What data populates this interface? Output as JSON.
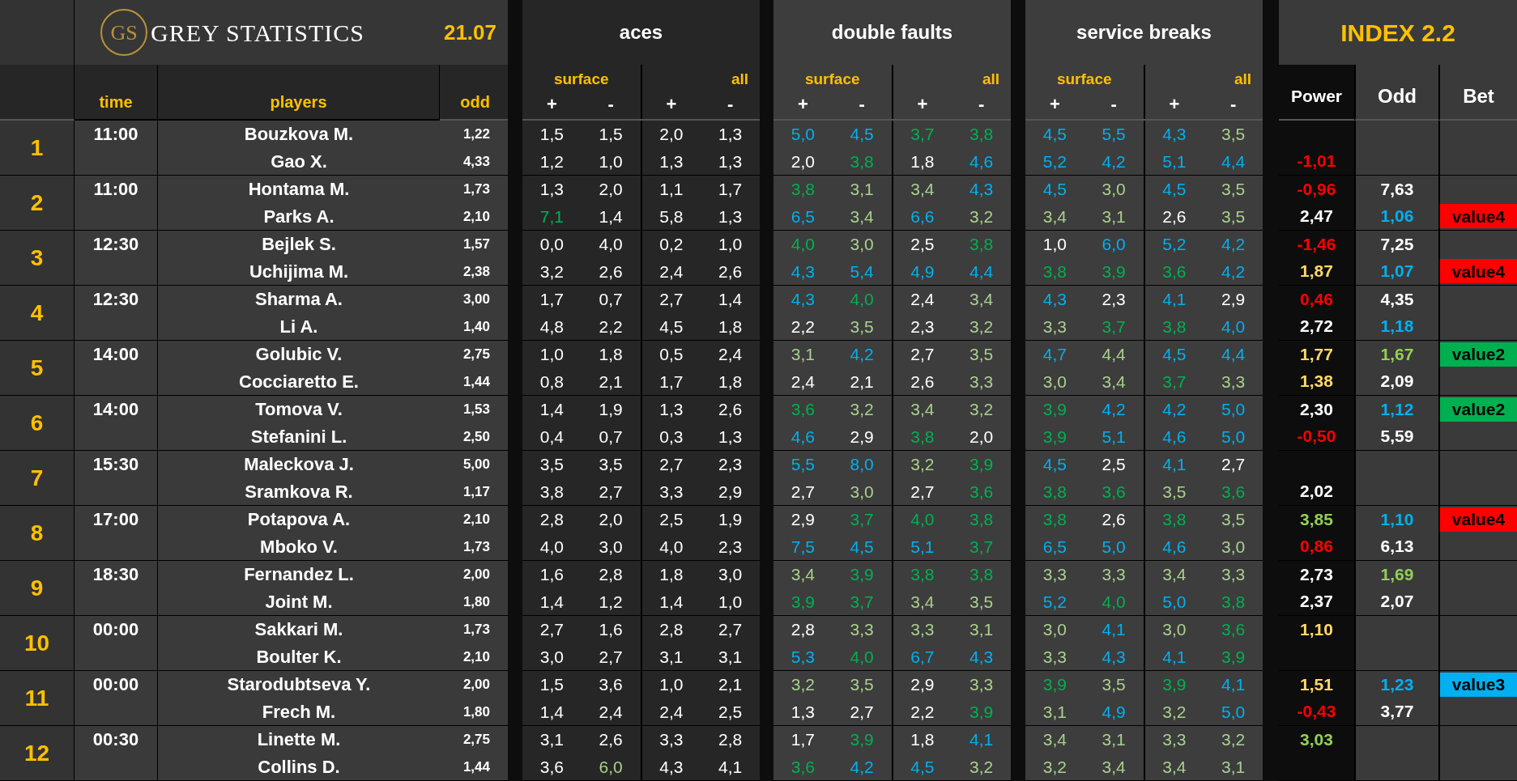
{
  "header": {
    "logo_mark": "GS",
    "brand": "GREY STATISTICS",
    "date": "21.07",
    "index_title": "INDEX 2.2"
  },
  "columns": {
    "time": "time",
    "players": "players",
    "odd": "odd",
    "power": "Power",
    "index_odd": "Odd",
    "bet": "Bet"
  },
  "groups": [
    {
      "title": "aces",
      "subgroups": [
        {
          "label": "surface",
          "signs": [
            "+",
            "-"
          ]
        },
        {
          "label": "all",
          "signs": [
            "+",
            "-"
          ]
        }
      ]
    },
    {
      "title": "double faults",
      "subgroups": [
        {
          "label": "surface",
          "signs": [
            "+",
            "-"
          ]
        },
        {
          "label": "all",
          "signs": [
            "+",
            "-"
          ]
        }
      ]
    },
    {
      "title": "service breaks",
      "subgroups": [
        {
          "label": "surface",
          "signs": [
            "+",
            "-"
          ]
        },
        {
          "label": "all",
          "signs": [
            "+",
            "-"
          ]
        }
      ]
    }
  ],
  "matches": [
    {
      "number": "1",
      "time": "11:00",
      "players": [
        {
          "name": "Bouzkova M.",
          "odd": "1,22",
          "stats": [
            {
              "text": "1,5",
              "color": "#ffffff"
            },
            {
              "text": "1,5",
              "color": "#ffffff"
            },
            {
              "text": "2,0",
              "color": "#ffffff"
            },
            {
              "text": "1,3",
              "color": "#ffffff"
            },
            {
              "text": "5,0",
              "color": "#00b0f0"
            },
            {
              "text": "4,5",
              "color": "#00b0f0"
            },
            {
              "text": "3,7",
              "color": "#00b050"
            },
            {
              "text": "3,8",
              "color": "#00b050"
            },
            {
              "text": "4,5",
              "color": "#00b0f0"
            },
            {
              "text": "5,5",
              "color": "#00b0f0"
            },
            {
              "text": "4,3",
              "color": "#00b0f0"
            },
            {
              "text": "3,5",
              "color": "#a9d08e"
            }
          ]
        },
        {
          "name": "Gao X.",
          "odd": "4,33",
          "stats": [
            {
              "text": "1,2",
              "color": "#ffffff"
            },
            {
              "text": "1,0",
              "color": "#ffffff"
            },
            {
              "text": "1,3",
              "color": "#ffffff"
            },
            {
              "text": "1,3",
              "color": "#ffffff"
            },
            {
              "text": "2,0",
              "color": "#ffffff"
            },
            {
              "text": "3,8",
              "color": "#00b050"
            },
            {
              "text": "1,8",
              "color": "#ffffff"
            },
            {
              "text": "4,6",
              "color": "#00b0f0"
            },
            {
              "text": "5,2",
              "color": "#00b0f0"
            },
            {
              "text": "4,2",
              "color": "#00b0f0"
            },
            {
              "text": "5,1",
              "color": "#00b0f0"
            },
            {
              "text": "4,4",
              "color": "#00b0f0"
            }
          ],
          "power": {
            "text": "-1,01",
            "color": "#ff0000"
          }
        }
      ]
    },
    {
      "number": "2",
      "time": "11:00",
      "players": [
        {
          "name": "Hontama M.",
          "odd": "1,73",
          "stats": [
            {
              "text": "1,3",
              "color": "#ffffff"
            },
            {
              "text": "2,0",
              "color": "#ffffff"
            },
            {
              "text": "1,1",
              "color": "#ffffff"
            },
            {
              "text": "1,7",
              "color": "#ffffff"
            },
            {
              "text": "3,8",
              "color": "#00b050"
            },
            {
              "text": "3,1",
              "color": "#a9d08e"
            },
            {
              "text": "3,4",
              "color": "#a9d08e"
            },
            {
              "text": "4,3",
              "color": "#00b0f0"
            },
            {
              "text": "4,5",
              "color": "#00b0f0"
            },
            {
              "text": "3,0",
              "color": "#a9d08e"
            },
            {
              "text": "4,5",
              "color": "#00b0f0"
            },
            {
              "text": "3,5",
              "color": "#a9d08e"
            }
          ],
          "power": {
            "text": "-0,96",
            "color": "#ff0000"
          },
          "index_odd": {
            "text": "7,63",
            "color": "#ffffff"
          }
        },
        {
          "name": "Parks A.",
          "odd": "2,10",
          "stats": [
            {
              "text": "7,1",
              "color": "#00b050"
            },
            {
              "text": "1,4",
              "color": "#ffffff"
            },
            {
              "text": "5,8",
              "color": "#ffffff"
            },
            {
              "text": "1,3",
              "color": "#ffffff"
            },
            {
              "text": "6,5",
              "color": "#00b0f0"
            },
            {
              "text": "3,4",
              "color": "#a9d08e"
            },
            {
              "text": "6,6",
              "color": "#00b0f0"
            },
            {
              "text": "3,2",
              "color": "#a9d08e"
            },
            {
              "text": "3,4",
              "color": "#a9d08e"
            },
            {
              "text": "3,1",
              "color": "#a9d08e"
            },
            {
              "text": "2,6",
              "color": "#ffffff"
            },
            {
              "text": "3,5",
              "color": "#a9d08e"
            }
          ],
          "power": {
            "text": "2,47",
            "color": "#ffffff"
          },
          "index_odd": {
            "text": "1,06",
            "color": "#00b0f0"
          },
          "bet": {
            "text": "value4",
            "color": "#ff0000"
          }
        }
      ]
    },
    {
      "number": "3",
      "time": "12:30",
      "players": [
        {
          "name": "Bejlek S.",
          "odd": "1,57",
          "stats": [
            {
              "text": "0,0",
              "color": "#ffffff"
            },
            {
              "text": "4,0",
              "color": "#ffffff"
            },
            {
              "text": "0,2",
              "color": "#ffffff"
            },
            {
              "text": "1,0",
              "color": "#ffffff"
            },
            {
              "text": "4,0",
              "color": "#00b050"
            },
            {
              "text": "3,0",
              "color": "#a9d08e"
            },
            {
              "text": "2,5",
              "color": "#ffffff"
            },
            {
              "text": "3,8",
              "color": "#00b050"
            },
            {
              "text": "1,0",
              "color": "#ffffff"
            },
            {
              "text": "6,0",
              "color": "#00b0f0"
            },
            {
              "text": "5,2",
              "color": "#00b0f0"
            },
            {
              "text": "4,2",
              "color": "#00b0f0"
            }
          ],
          "power": {
            "text": "-1,46",
            "color": "#ff0000"
          },
          "index_odd": {
            "text": "7,25",
            "color": "#ffffff"
          }
        },
        {
          "name": "Uchijima M.",
          "odd": "2,38",
          "stats": [
            {
              "text": "3,2",
              "color": "#ffffff"
            },
            {
              "text": "2,6",
              "color": "#ffffff"
            },
            {
              "text": "2,4",
              "color": "#ffffff"
            },
            {
              "text": "2,6",
              "color": "#ffffff"
            },
            {
              "text": "4,3",
              "color": "#00b0f0"
            },
            {
              "text": "5,4",
              "color": "#00b0f0"
            },
            {
              "text": "4,9",
              "color": "#00b0f0"
            },
            {
              "text": "4,4",
              "color": "#00b0f0"
            },
            {
              "text": "3,8",
              "color": "#00b050"
            },
            {
              "text": "3,9",
              "color": "#00b050"
            },
            {
              "text": "3,6",
              "color": "#00b050"
            },
            {
              "text": "4,2",
              "color": "#00b0f0"
            }
          ],
          "power": {
            "text": "1,87",
            "color": "#ffd966"
          },
          "index_odd": {
            "text": "1,07",
            "color": "#00b0f0"
          },
          "bet": {
            "text": "value4",
            "color": "#ff0000"
          }
        }
      ]
    },
    {
      "number": "4",
      "time": "12:30",
      "players": [
        {
          "name": "Sharma A.",
          "odd": "3,00",
          "stats": [
            {
              "text": "1,7",
              "color": "#ffffff"
            },
            {
              "text": "0,7",
              "color": "#ffffff"
            },
            {
              "text": "2,7",
              "color": "#ffffff"
            },
            {
              "text": "1,4",
              "color": "#ffffff"
            },
            {
              "text": "4,3",
              "color": "#00b0f0"
            },
            {
              "text": "4,0",
              "color": "#00b050"
            },
            {
              "text": "2,4",
              "color": "#ffffff"
            },
            {
              "text": "3,4",
              "color": "#a9d08e"
            },
            {
              "text": "4,3",
              "color": "#00b0f0"
            },
            {
              "text": "2,3",
              "color": "#ffffff"
            },
            {
              "text": "4,1",
              "color": "#00b0f0"
            },
            {
              "text": "2,9",
              "color": "#ffffff"
            }
          ],
          "power": {
            "text": "0,46",
            "color": "#ff0000"
          },
          "index_odd": {
            "text": "4,35",
            "color": "#ffffff"
          }
        },
        {
          "name": "Li A.",
          "odd": "1,40",
          "stats": [
            {
              "text": "4,8",
              "color": "#ffffff"
            },
            {
              "text": "2,2",
              "color": "#ffffff"
            },
            {
              "text": "4,5",
              "color": "#ffffff"
            },
            {
              "text": "1,8",
              "color": "#ffffff"
            },
            {
              "text": "2,2",
              "color": "#ffffff"
            },
            {
              "text": "3,5",
              "color": "#a9d08e"
            },
            {
              "text": "2,3",
              "color": "#ffffff"
            },
            {
              "text": "3,2",
              "color": "#a9d08e"
            },
            {
              "text": "3,3",
              "color": "#a9d08e"
            },
            {
              "text": "3,7",
              "color": "#00b050"
            },
            {
              "text": "3,8",
              "color": "#00b050"
            },
            {
              "text": "4,0",
              "color": "#00b0f0"
            }
          ],
          "power": {
            "text": "2,72",
            "color": "#ffffff"
          },
          "index_odd": {
            "text": "1,18",
            "color": "#00b0f0"
          }
        }
      ]
    },
    {
      "number": "5",
      "time": "14:00",
      "players": [
        {
          "name": "Golubic V.",
          "odd": "2,75",
          "stats": [
            {
              "text": "1,0",
              "color": "#ffffff"
            },
            {
              "text": "1,8",
              "color": "#ffffff"
            },
            {
              "text": "0,5",
              "color": "#ffffff"
            },
            {
              "text": "2,4",
              "color": "#ffffff"
            },
            {
              "text": "3,1",
              "color": "#a9d08e"
            },
            {
              "text": "4,2",
              "color": "#00b0f0"
            },
            {
              "text": "2,7",
              "color": "#ffffff"
            },
            {
              "text": "3,5",
              "color": "#a9d08e"
            },
            {
              "text": "4,7",
              "color": "#00b0f0"
            },
            {
              "text": "4,4",
              "color": "#a9d08e"
            },
            {
              "text": "4,5",
              "color": "#00b0f0"
            },
            {
              "text": "4,4",
              "color": "#00b0f0"
            }
          ],
          "power": {
            "text": "1,77",
            "color": "#ffd966"
          },
          "index_odd": {
            "text": "1,67",
            "color": "#92d050"
          },
          "bet": {
            "text": "value2",
            "color": "#00b050"
          }
        },
        {
          "name": "Cocciaretto E.",
          "odd": "1,44",
          "stats": [
            {
              "text": "0,8",
              "color": "#ffffff"
            },
            {
              "text": "2,1",
              "color": "#ffffff"
            },
            {
              "text": "1,7",
              "color": "#ffffff"
            },
            {
              "text": "1,8",
              "color": "#ffffff"
            },
            {
              "text": "2,4",
              "color": "#ffffff"
            },
            {
              "text": "2,1",
              "color": "#ffffff"
            },
            {
              "text": "2,6",
              "color": "#ffffff"
            },
            {
              "text": "3,3",
              "color": "#a9d08e"
            },
            {
              "text": "3,0",
              "color": "#a9d08e"
            },
            {
              "text": "3,4",
              "color": "#a9d08e"
            },
            {
              "text": "3,7",
              "color": "#00b050"
            },
            {
              "text": "3,3",
              "color": "#a9d08e"
            }
          ],
          "power": {
            "text": "1,38",
            "color": "#ffd966"
          },
          "index_odd": {
            "text": "2,09",
            "color": "#ffffff"
          }
        }
      ]
    },
    {
      "number": "6",
      "time": "14:00",
      "players": [
        {
          "name": "Tomova V.",
          "odd": "1,53",
          "stats": [
            {
              "text": "1,4",
              "color": "#ffffff"
            },
            {
              "text": "1,9",
              "color": "#ffffff"
            },
            {
              "text": "1,3",
              "color": "#ffffff"
            },
            {
              "text": "2,6",
              "color": "#ffffff"
            },
            {
              "text": "3,6",
              "color": "#00b050"
            },
            {
              "text": "3,2",
              "color": "#a9d08e"
            },
            {
              "text": "3,4",
              "color": "#a9d08e"
            },
            {
              "text": "3,2",
              "color": "#a9d08e"
            },
            {
              "text": "3,9",
              "color": "#00b050"
            },
            {
              "text": "4,2",
              "color": "#00b0f0"
            },
            {
              "text": "4,2",
              "color": "#00b0f0"
            },
            {
              "text": "5,0",
              "color": "#00b0f0"
            }
          ],
          "power": {
            "text": "2,30",
            "color": "#ffffff"
          },
          "index_odd": {
            "text": "1,12",
            "color": "#00b0f0"
          },
          "bet": {
            "text": "value2",
            "color": "#00b050"
          }
        },
        {
          "name": "Stefanini L.",
          "odd": "2,50",
          "stats": [
            {
              "text": "0,4",
              "color": "#ffffff"
            },
            {
              "text": "0,7",
              "color": "#ffffff"
            },
            {
              "text": "0,3",
              "color": "#ffffff"
            },
            {
              "text": "1,3",
              "color": "#ffffff"
            },
            {
              "text": "4,6",
              "color": "#00b0f0"
            },
            {
              "text": "2,9",
              "color": "#ffffff"
            },
            {
              "text": "3,8",
              "color": "#00b050"
            },
            {
              "text": "2,0",
              "color": "#ffffff"
            },
            {
              "text": "3,9",
              "color": "#00b050"
            },
            {
              "text": "5,1",
              "color": "#00b0f0"
            },
            {
              "text": "4,6",
              "color": "#00b0f0"
            },
            {
              "text": "5,0",
              "color": "#00b0f0"
            }
          ],
          "power": {
            "text": "-0,50",
            "color": "#ff0000"
          },
          "index_odd": {
            "text": "5,59",
            "color": "#ffffff"
          }
        }
      ]
    },
    {
      "number": "7",
      "time": "15:30",
      "players": [
        {
          "name": "Maleckova J.",
          "odd": "5,00",
          "stats": [
            {
              "text": "3,5",
              "color": "#ffffff"
            },
            {
              "text": "3,5",
              "color": "#ffffff"
            },
            {
              "text": "2,7",
              "color": "#ffffff"
            },
            {
              "text": "2,3",
              "color": "#ffffff"
            },
            {
              "text": "5,5",
              "color": "#00b0f0"
            },
            {
              "text": "8,0",
              "color": "#00b0f0"
            },
            {
              "text": "3,2",
              "color": "#a9d08e"
            },
            {
              "text": "3,9",
              "color": "#00b050"
            },
            {
              "text": "4,5",
              "color": "#00b0f0"
            },
            {
              "text": "2,5",
              "color": "#ffffff"
            },
            {
              "text": "4,1",
              "color": "#00b0f0"
            },
            {
              "text": "2,7",
              "color": "#ffffff"
            }
          ]
        },
        {
          "name": "Sramkova R.",
          "odd": "1,17",
          "stats": [
            {
              "text": "3,8",
              "color": "#ffffff"
            },
            {
              "text": "2,7",
              "color": "#ffffff"
            },
            {
              "text": "3,3",
              "color": "#ffffff"
            },
            {
              "text": "2,9",
              "color": "#ffffff"
            },
            {
              "text": "2,7",
              "color": "#ffffff"
            },
            {
              "text": "3,0",
              "color": "#a9d08e"
            },
            {
              "text": "2,7",
              "color": "#ffffff"
            },
            {
              "text": "3,6",
              "color": "#00b050"
            },
            {
              "text": "3,8",
              "color": "#00b050"
            },
            {
              "text": "3,6",
              "color": "#00b050"
            },
            {
              "text": "3,5",
              "color": "#a9d08e"
            },
            {
              "text": "3,6",
              "color": "#00b050"
            }
          ],
          "power": {
            "text": "2,02",
            "color": "#ffffff"
          }
        }
      ]
    },
    {
      "number": "8",
      "time": "17:00",
      "players": [
        {
          "name": "Potapova A.",
          "odd": "2,10",
          "stats": [
            {
              "text": "2,8",
              "color": "#ffffff"
            },
            {
              "text": "2,0",
              "color": "#ffffff"
            },
            {
              "text": "2,5",
              "color": "#ffffff"
            },
            {
              "text": "1,9",
              "color": "#ffffff"
            },
            {
              "text": "2,9",
              "color": "#ffffff"
            },
            {
              "text": "3,7",
              "color": "#00b050"
            },
            {
              "text": "4,0",
              "color": "#00b050"
            },
            {
              "text": "3,8",
              "color": "#00b050"
            },
            {
              "text": "3,8",
              "color": "#00b050"
            },
            {
              "text": "2,6",
              "color": "#ffffff"
            },
            {
              "text": "3,8",
              "color": "#00b050"
            },
            {
              "text": "3,5",
              "color": "#a9d08e"
            }
          ],
          "power": {
            "text": "3,85",
            "color": "#92d050"
          },
          "index_odd": {
            "text": "1,10",
            "color": "#00b0f0"
          },
          "bet": {
            "text": "value4",
            "color": "#ff0000"
          }
        },
        {
          "name": "Mboko V.",
          "odd": "1,73",
          "stats": [
            {
              "text": "4,0",
              "color": "#ffffff"
            },
            {
              "text": "3,0",
              "color": "#ffffff"
            },
            {
              "text": "4,0",
              "color": "#ffffff"
            },
            {
              "text": "2,3",
              "color": "#ffffff"
            },
            {
              "text": "7,5",
              "color": "#00b0f0"
            },
            {
              "text": "4,5",
              "color": "#00b0f0"
            },
            {
              "text": "5,1",
              "color": "#00b0f0"
            },
            {
              "text": "3,7",
              "color": "#00b050"
            },
            {
              "text": "6,5",
              "color": "#00b0f0"
            },
            {
              "text": "5,0",
              "color": "#00b0f0"
            },
            {
              "text": "4,6",
              "color": "#00b0f0"
            },
            {
              "text": "3,0",
              "color": "#a9d08e"
            }
          ],
          "power": {
            "text": "0,86",
            "color": "#ff0000"
          },
          "index_odd": {
            "text": "6,13",
            "color": "#ffffff"
          }
        }
      ]
    },
    {
      "number": "9",
      "time": "18:30",
      "players": [
        {
          "name": "Fernandez L.",
          "odd": "2,00",
          "stats": [
            {
              "text": "1,6",
              "color": "#ffffff"
            },
            {
              "text": "2,8",
              "color": "#ffffff"
            },
            {
              "text": "1,8",
              "color": "#ffffff"
            },
            {
              "text": "3,0",
              "color": "#ffffff"
            },
            {
              "text": "3,4",
              "color": "#a9d08e"
            },
            {
              "text": "3,9",
              "color": "#00b050"
            },
            {
              "text": "3,8",
              "color": "#00b050"
            },
            {
              "text": "3,8",
              "color": "#00b050"
            },
            {
              "text": "3,3",
              "color": "#a9d08e"
            },
            {
              "text": "3,3",
              "color": "#a9d08e"
            },
            {
              "text": "3,4",
              "color": "#a9d08e"
            },
            {
              "text": "3,3",
              "color": "#a9d08e"
            }
          ],
          "power": {
            "text": "2,73",
            "color": "#ffffff"
          },
          "index_odd": {
            "text": "1,69",
            "color": "#92d050"
          }
        },
        {
          "name": "Joint M.",
          "odd": "1,80",
          "stats": [
            {
              "text": "1,4",
              "color": "#ffffff"
            },
            {
              "text": "1,2",
              "color": "#ffffff"
            },
            {
              "text": "1,4",
              "color": "#ffffff"
            },
            {
              "text": "1,0",
              "color": "#ffffff"
            },
            {
              "text": "3,9",
              "color": "#00b050"
            },
            {
              "text": "3,7",
              "color": "#00b050"
            },
            {
              "text": "3,4",
              "color": "#a9d08e"
            },
            {
              "text": "3,5",
              "color": "#a9d08e"
            },
            {
              "text": "5,2",
              "color": "#00b0f0"
            },
            {
              "text": "4,0",
              "color": "#00b050"
            },
            {
              "text": "5,0",
              "color": "#00b0f0"
            },
            {
              "text": "3,8",
              "color": "#00b050"
            }
          ],
          "power": {
            "text": "2,37",
            "color": "#ffffff"
          },
          "index_odd": {
            "text": "2,07",
            "color": "#ffffff"
          }
        }
      ]
    },
    {
      "number": "10",
      "time": "00:00",
      "players": [
        {
          "name": "Sakkari M.",
          "odd": "1,73",
          "stats": [
            {
              "text": "2,7",
              "color": "#ffffff"
            },
            {
              "text": "1,6",
              "color": "#ffffff"
            },
            {
              "text": "2,8",
              "color": "#ffffff"
            },
            {
              "text": "2,7",
              "color": "#ffffff"
            },
            {
              "text": "2,8",
              "color": "#ffffff"
            },
            {
              "text": "3,3",
              "color": "#a9d08e"
            },
            {
              "text": "3,3",
              "color": "#a9d08e"
            },
            {
              "text": "3,1",
              "color": "#a9d08e"
            },
            {
              "text": "3,0",
              "color": "#a9d08e"
            },
            {
              "text": "4,1",
              "color": "#00b0f0"
            },
            {
              "text": "3,0",
              "color": "#a9d08e"
            },
            {
              "text": "3,6",
              "color": "#00b050"
            }
          ],
          "power": {
            "text": "1,10",
            "color": "#ffd966"
          }
        },
        {
          "name": "Boulter K.",
          "odd": "2,10",
          "stats": [
            {
              "text": "3,0",
              "color": "#ffffff"
            },
            {
              "text": "2,7",
              "color": "#ffffff"
            },
            {
              "text": "3,1",
              "color": "#ffffff"
            },
            {
              "text": "3,1",
              "color": "#ffffff"
            },
            {
              "text": "5,3",
              "color": "#00b0f0"
            },
            {
              "text": "4,0",
              "color": "#00b050"
            },
            {
              "text": "6,7",
              "color": "#00b0f0"
            },
            {
              "text": "4,3",
              "color": "#00b0f0"
            },
            {
              "text": "3,3",
              "color": "#a9d08e"
            },
            {
              "text": "4,3",
              "color": "#00b0f0"
            },
            {
              "text": "4,1",
              "color": "#00b0f0"
            },
            {
              "text": "3,9",
              "color": "#00b050"
            }
          ]
        }
      ]
    },
    {
      "number": "11",
      "time": "00:00",
      "players": [
        {
          "name": "Starodubtseva Y.",
          "odd": "2,00",
          "stats": [
            {
              "text": "1,5",
              "color": "#ffffff"
            },
            {
              "text": "3,6",
              "color": "#ffffff"
            },
            {
              "text": "1,0",
              "color": "#ffffff"
            },
            {
              "text": "2,1",
              "color": "#ffffff"
            },
            {
              "text": "3,2",
              "color": "#a9d08e"
            },
            {
              "text": "3,5",
              "color": "#a9d08e"
            },
            {
              "text": "2,9",
              "color": "#ffffff"
            },
            {
              "text": "3,3",
              "color": "#a9d08e"
            },
            {
              "text": "3,9",
              "color": "#00b050"
            },
            {
              "text": "3,5",
              "color": "#a9d08e"
            },
            {
              "text": "3,9",
              "color": "#00b050"
            },
            {
              "text": "4,1",
              "color": "#00b0f0"
            }
          ],
          "power": {
            "text": "1,51",
            "color": "#ffd966"
          },
          "index_odd": {
            "text": "1,23",
            "color": "#00b0f0"
          },
          "bet": {
            "text": "value3",
            "color": "#00b0f0"
          }
        },
        {
          "name": "Frech M.",
          "odd": "1,80",
          "stats": [
            {
              "text": "1,4",
              "color": "#ffffff"
            },
            {
              "text": "2,4",
              "color": "#ffffff"
            },
            {
              "text": "2,4",
              "color": "#ffffff"
            },
            {
              "text": "2,5",
              "color": "#ffffff"
            },
            {
              "text": "1,3",
              "color": "#ffffff"
            },
            {
              "text": "2,7",
              "color": "#ffffff"
            },
            {
              "text": "2,2",
              "color": "#ffffff"
            },
            {
              "text": "3,9",
              "color": "#00b050"
            },
            {
              "text": "3,1",
              "color": "#a9d08e"
            },
            {
              "text": "4,9",
              "color": "#00b0f0"
            },
            {
              "text": "3,2",
              "color": "#a9d08e"
            },
            {
              "text": "5,0",
              "color": "#00b0f0"
            }
          ],
          "power": {
            "text": "-0,43",
            "color": "#ff0000"
          },
          "index_odd": {
            "text": "3,77",
            "color": "#ffffff"
          }
        }
      ]
    },
    {
      "number": "12",
      "time": "00:30",
      "players": [
        {
          "name": "Linette M.",
          "odd": "2,75",
          "stats": [
            {
              "text": "3,1",
              "color": "#ffffff"
            },
            {
              "text": "2,6",
              "color": "#ffffff"
            },
            {
              "text": "3,3",
              "color": "#ffffff"
            },
            {
              "text": "2,8",
              "color": "#ffffff"
            },
            {
              "text": "1,7",
              "color": "#ffffff"
            },
            {
              "text": "3,9",
              "color": "#00b050"
            },
            {
              "text": "1,8",
              "color": "#ffffff"
            },
            {
              "text": "4,1",
              "color": "#00b0f0"
            },
            {
              "text": "3,4",
              "color": "#a9d08e"
            },
            {
              "text": "3,1",
              "color": "#a9d08e"
            },
            {
              "text": "3,3",
              "color": "#a9d08e"
            },
            {
              "text": "3,2",
              "color": "#a9d08e"
            }
          ],
          "power": {
            "text": "3,03",
            "color": "#92d050"
          }
        },
        {
          "name": "Collins D.",
          "odd": "1,44",
          "stats": [
            {
              "text": "3,6",
              "color": "#ffffff"
            },
            {
              "text": "6,0",
              "color": "#a9d08e"
            },
            {
              "text": "4,3",
              "color": "#ffffff"
            },
            {
              "text": "4,1",
              "color": "#ffffff"
            },
            {
              "text": "3,6",
              "color": "#00b050"
            },
            {
              "text": "4,2",
              "color": "#00b0f0"
            },
            {
              "text": "4,5",
              "color": "#00b0f0"
            },
            {
              "text": "3,2",
              "color": "#a9d08e"
            },
            {
              "text": "3,2",
              "color": "#a9d08e"
            },
            {
              "text": "3,4",
              "color": "#a9d08e"
            },
            {
              "text": "3,4",
              "color": "#a9d08e"
            },
            {
              "text": "3,1",
              "color": "#a9d08e"
            }
          ]
        }
      ]
    }
  ]
}
